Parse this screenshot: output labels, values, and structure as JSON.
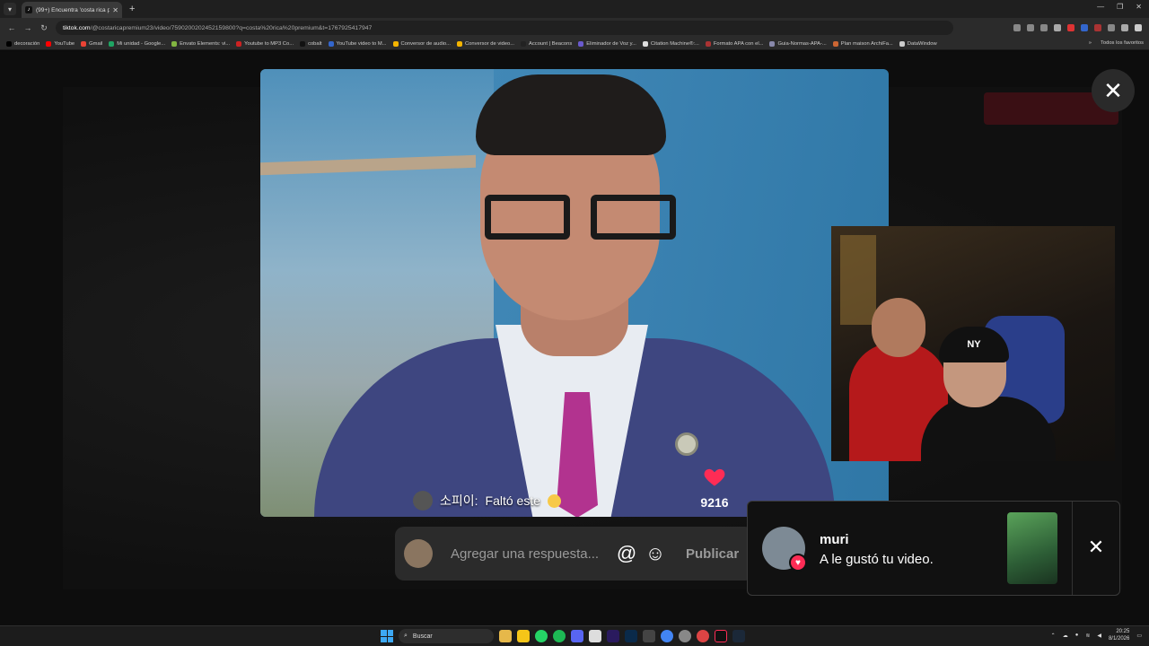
{
  "browser": {
    "tab_title": "(99+) Encuentra 'costa rica prem",
    "url_host": "tiktok.com",
    "url_path": "/@costaricapremium23/video/7590200202452159800?q=costa%20rica%20premium&t=1767925417947"
  },
  "bookmarks": [
    {
      "label": "decoración",
      "color": "#000000"
    },
    {
      "label": "YouTube",
      "color": "#ff0000"
    },
    {
      "label": "Gmail",
      "color": "#ea4335"
    },
    {
      "label": "Mi unidad - Google...",
      "color": "#1fa463"
    },
    {
      "label": "Envato Elements: vi...",
      "color": "#82b541"
    },
    {
      "label": "Youtube to MP3 Co...",
      "color": "#cc2222"
    },
    {
      "label": "cobalt",
      "color": "#111111"
    },
    {
      "label": "YouTube video to M...",
      "color": "#3366cc"
    },
    {
      "label": "Conversor de audio...",
      "color": "#f4b400"
    },
    {
      "label": "Conversor de video...",
      "color": "#f4b400"
    },
    {
      "label": "Account | Beacons",
      "color": "#222222"
    },
    {
      "label": "Eliminador de Voz y...",
      "color": "#6a5acd"
    },
    {
      "label": "Citation Machine®:...",
      "color": "#dddddd"
    },
    {
      "label": "Formato APA con el...",
      "color": "#aa3333"
    },
    {
      "label": "Guia-Normas-APA-...",
      "color": "#8888aa"
    },
    {
      "label": "Plan maison ArchiFa...",
      "color": "#cc6633"
    },
    {
      "label": "DataWindow",
      "color": "#cccccc"
    }
  ],
  "bookmarks_right": "Todos los favoritos",
  "video": {
    "comment_user": "소피이:",
    "comment_text": "Faltó este",
    "like_count": "9216",
    "like_color": "#fe2c55"
  },
  "webcam": {
    "cap_text": "NY"
  },
  "reply": {
    "placeholder": "Agregar una respuesta...",
    "at_symbol": "@",
    "emoji_symbol": "☺",
    "publish_label": "Publicar"
  },
  "notification": {
    "name": "muri",
    "message": "A le gustó tu video.",
    "close_symbol": "✕",
    "badge_icon": "heart-icon"
  },
  "close_symbol": "✕",
  "taskbar": {
    "search_label": "Buscar",
    "time": "20:25",
    "date": "8/1/2026"
  }
}
